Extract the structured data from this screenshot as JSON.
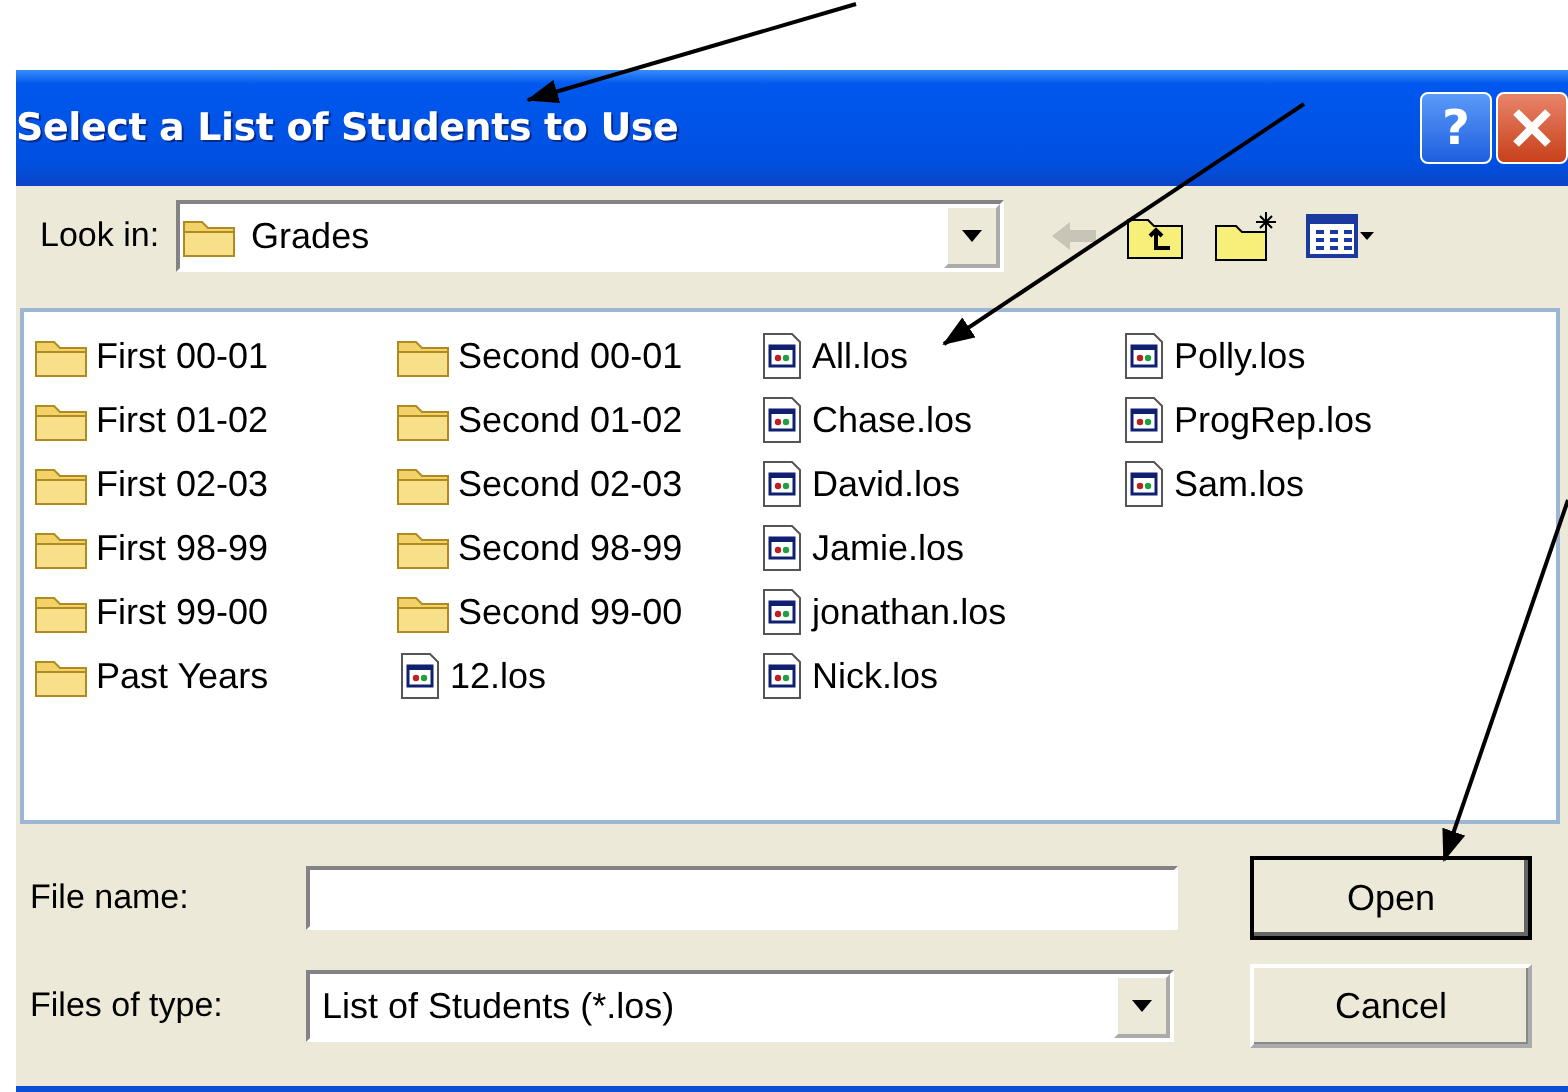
{
  "window": {
    "title": "Select a List of Students to Use",
    "title_buttons": [
      "?"
    ]
  },
  "look_in": {
    "label": "Look in:",
    "value": "Grades"
  },
  "files": [
    {
      "name": "First 00-01",
      "kind": "folder"
    },
    {
      "name": "First 01-02",
      "kind": "folder"
    },
    {
      "name": "First 02-03",
      "kind": "folder"
    },
    {
      "name": "First 98-99",
      "kind": "folder"
    },
    {
      "name": "First 99-00",
      "kind": "folder"
    },
    {
      "name": "Past Years",
      "kind": "folder"
    },
    {
      "name": "Second 00-01",
      "kind": "folder"
    },
    {
      "name": "Second 01-02",
      "kind": "folder"
    },
    {
      "name": "Second 02-03",
      "kind": "folder"
    },
    {
      "name": "Second 98-99",
      "kind": "folder"
    },
    {
      "name": "Second 99-00",
      "kind": "folder"
    },
    {
      "name": "12.los",
      "kind": "file"
    },
    {
      "name": "All.los",
      "kind": "file"
    },
    {
      "name": "Chase.los",
      "kind": "file"
    },
    {
      "name": "David.los",
      "kind": "file"
    },
    {
      "name": "Jamie.los",
      "kind": "file"
    },
    {
      "name": "jonathan.los",
      "kind": "file"
    },
    {
      "name": "Nick.los",
      "kind": "file"
    },
    {
      "name": "Polly.los",
      "kind": "file"
    },
    {
      "name": "ProgRep.los",
      "kind": "file"
    },
    {
      "name": "Sam.los",
      "kind": "file"
    }
  ],
  "file_name": {
    "label": "File name:"
  },
  "file_type": {
    "label": "Files of type:",
    "value": "List of Students (*.los)"
  },
  "buttons": [
    {
      "label": "Open",
      "default": true
    },
    {
      "label": "Cancel",
      "default": false
    }
  ]
}
